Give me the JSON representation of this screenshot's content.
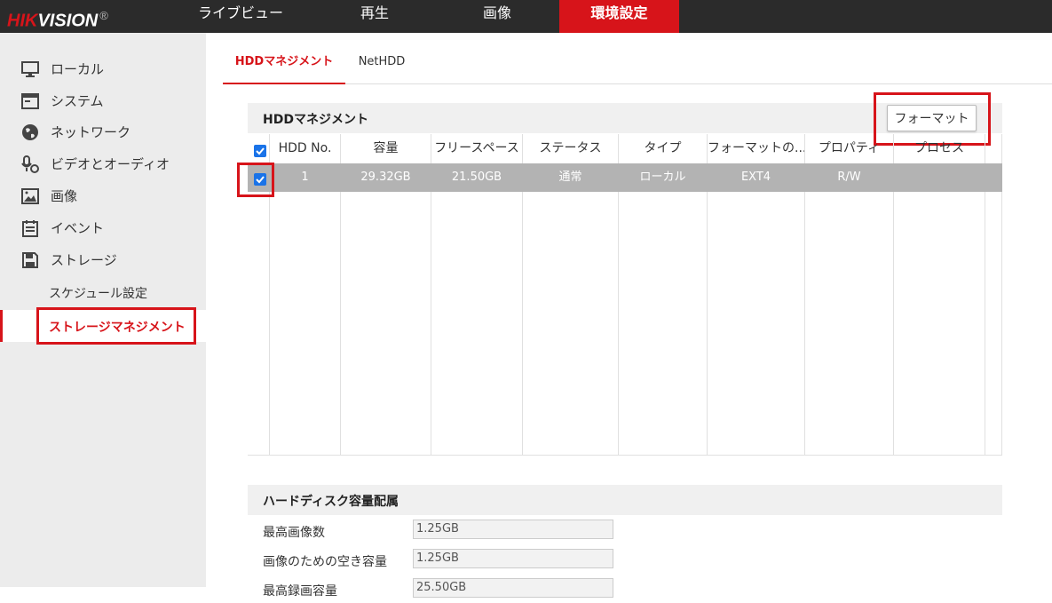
{
  "brand": {
    "name_red": "HIK",
    "name_white": "VISION",
    "reg": "®"
  },
  "topnav": [
    {
      "label": "ライブビュー"
    },
    {
      "label": "再生"
    },
    {
      "label": "画像"
    },
    {
      "label": "環境設定",
      "active": true
    }
  ],
  "sidebar": {
    "items": [
      {
        "label": "ローカル",
        "icon": "monitor-icon"
      },
      {
        "label": "システム",
        "icon": "system-window-icon"
      },
      {
        "label": "ネットワーク",
        "icon": "globe-icon"
      },
      {
        "label": "ビデオとオーディオ",
        "icon": "microphone-camera-icon"
      },
      {
        "label": "画像",
        "icon": "image-icon"
      },
      {
        "label": "イベント",
        "icon": "calendar-icon"
      },
      {
        "label": "ストレージ",
        "icon": "save-disk-icon"
      }
    ],
    "subitems": [
      {
        "label": "スケジュール設定"
      },
      {
        "label": "ストレージマネジメント",
        "active": true
      }
    ]
  },
  "tabs": [
    {
      "label": "HDDマネジメント",
      "active": true
    },
    {
      "label": "NetHDD"
    }
  ],
  "hdd": {
    "title": "HDDマネジメント",
    "format_button": "フォーマット",
    "columns": [
      "HDD No.",
      "容量",
      "フリースペース",
      "ステータス",
      "タイプ",
      "フォーマットの...",
      "プロパティ",
      "プロセス"
    ],
    "rows": [
      {
        "no": "1",
        "capacity": "29.32GB",
        "free": "21.50GB",
        "status": "通常",
        "type": "ローカル",
        "format": "EXT4",
        "property": "R/W",
        "process": "",
        "checked": true
      }
    ],
    "select_all_checked": true
  },
  "allocation": {
    "title": "ハードディスク容量配属",
    "fields": [
      {
        "label": "最高画像数",
        "value": "1.25GB"
      },
      {
        "label": "画像のための空き容量",
        "value": "1.25GB"
      },
      {
        "label": "最高録画容量",
        "value": "25.50GB"
      }
    ]
  },
  "colors": {
    "accent": "#d7141a",
    "topbar": "#2b2b2b",
    "sidebar": "#ececec",
    "row_selected": "#b3b3b3",
    "checkbox": "#1a73e8"
  }
}
